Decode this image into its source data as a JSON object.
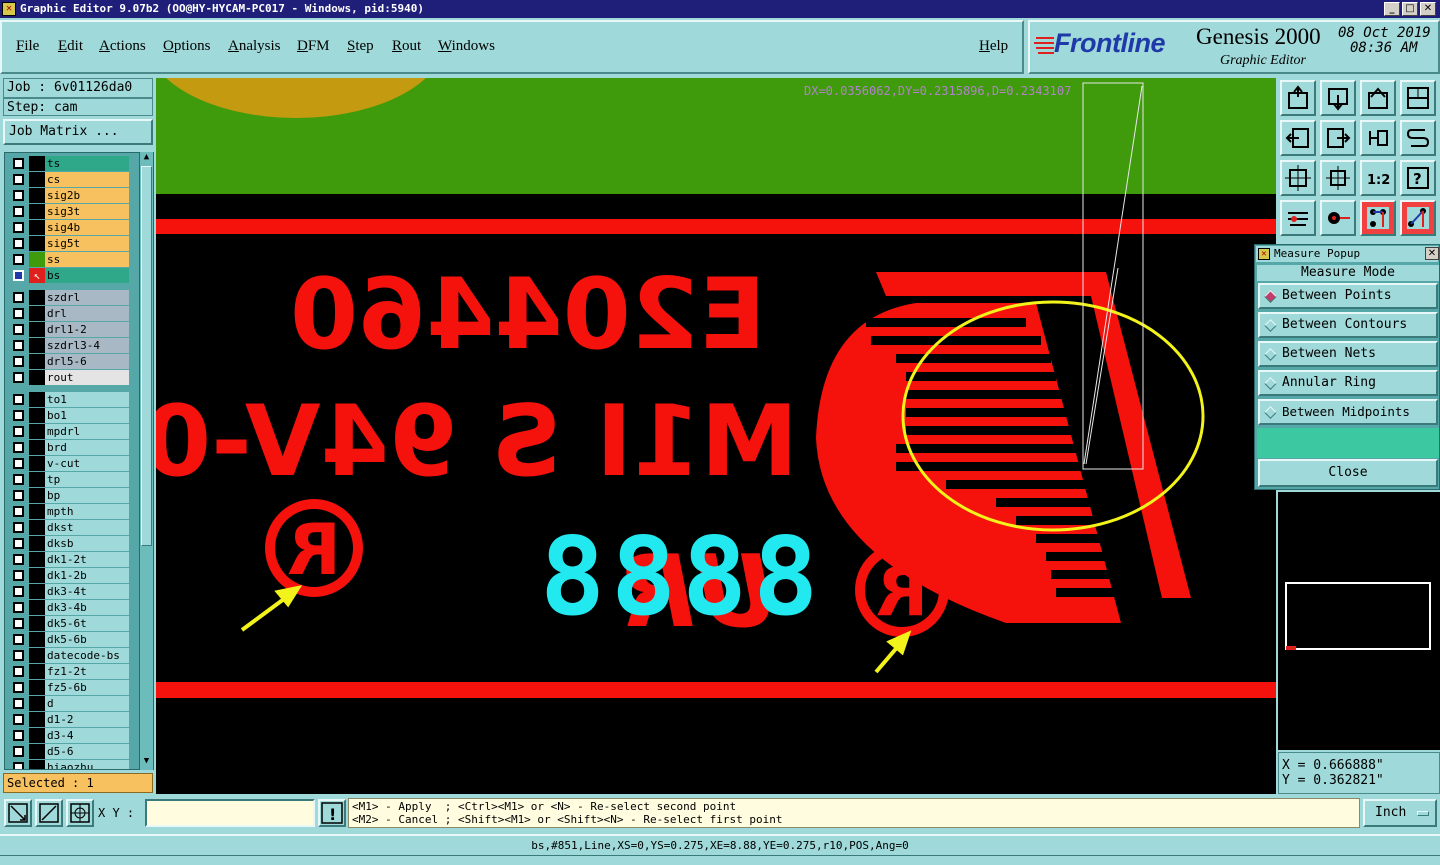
{
  "window": {
    "title": "Graphic Editor 9.07b2 (OO@HY-HYCAM-PC017 - Windows, pid:5940)"
  },
  "menu": {
    "items": [
      "File",
      "Edit",
      "Actions",
      "Options",
      "Analysis",
      "DFM",
      "Step",
      "Rout",
      "Windows"
    ],
    "help": "Help"
  },
  "logo": {
    "brand": "Frontline",
    "product": "Genesis 2000",
    "subtitle": "Graphic Editor",
    "date": "08 Oct 2019",
    "time": "08:36 AM"
  },
  "job": {
    "job_label": "Job : 6v01126da0",
    "step_label": "Step: cam",
    "matrix_button": "Job Matrix ..."
  },
  "layers": {
    "group1": [
      {
        "name": "ts",
        "color": "#2fa88a"
      },
      {
        "name": "cs",
        "color": "#f7c15f"
      },
      {
        "name": "sig2b",
        "color": "#f7c15f"
      },
      {
        "name": "sig3t",
        "color": "#f7c15f"
      },
      {
        "name": "sig4b",
        "color": "#f7c15f"
      },
      {
        "name": "sig5t",
        "color": "#f7c15f"
      },
      {
        "name": "ss",
        "color": "#f7c15f"
      },
      {
        "name": "bs",
        "color": "#2fa88a"
      }
    ],
    "group2": [
      {
        "name": "szdrl",
        "color": "#a8b8c4"
      },
      {
        "name": "drl",
        "color": "#a8b8c4"
      },
      {
        "name": "drl1-2",
        "color": "#a8b8c4"
      },
      {
        "name": "szdrl3-4",
        "color": "#a8b8c4"
      },
      {
        "name": "drl5-6",
        "color": "#a8b8c4"
      },
      {
        "name": "rout",
        "color": "#e4e4e4"
      }
    ],
    "group3": [
      {
        "name": "to1"
      },
      {
        "name": "bo1"
      },
      {
        "name": "mpdrl"
      },
      {
        "name": "brd"
      },
      {
        "name": "v-cut"
      },
      {
        "name": "tp"
      },
      {
        "name": "bp"
      },
      {
        "name": "mpth"
      },
      {
        "name": "dkst"
      },
      {
        "name": "dksb"
      },
      {
        "name": "dk1-2t"
      },
      {
        "name": "dk1-2b"
      },
      {
        "name": "dk3-4t"
      },
      {
        "name": "dk3-4b"
      },
      {
        "name": "dk5-6t"
      },
      {
        "name": "dk5-6b"
      },
      {
        "name": "datecode-bs"
      },
      {
        "name": "fz1-2t"
      },
      {
        "name": "fz5-6b"
      },
      {
        "name": "d"
      },
      {
        "name": "d1-2"
      },
      {
        "name": "d3-4"
      },
      {
        "name": "d5-6"
      },
      {
        "name": "hiaozhu"
      }
    ],
    "group3_color": "#9fd9d9",
    "selected": "Selected : 1"
  },
  "canvas": {
    "measure_readout": "DX=0.0356062,DY=0.2315896,D=0.2343107",
    "text_line1": "E204460",
    "text_line2": "M1I S 94V-0",
    "ul_mark": "UR",
    "datecode": "8888",
    "registered": "R"
  },
  "measure_popup": {
    "title": "Measure Popup",
    "mode_label": "Measure Mode",
    "options": [
      "Between Points",
      "Between Contours",
      "Between Nets",
      "Annular Ring",
      "Between Midpoints"
    ],
    "selected_index": 0,
    "close": "Close"
  },
  "coords": {
    "x": "X = 0.666888\"",
    "y": "Y = 0.362821\""
  },
  "command": {
    "xy_label": "X Y :",
    "xy_value": "",
    "hint1": "<M1> - Apply  ; <Ctrl><M1> or <N> - Re-select second point",
    "hint2": "<M2> - Cancel ; <Shift><M1> or <Shift><N> - Re-select first point",
    "units": "Inch"
  },
  "status": "bs,#851,Line,XS=0,YS=0.275,XE=8.88,YE=0.275,r10,POS,Ang=0"
}
